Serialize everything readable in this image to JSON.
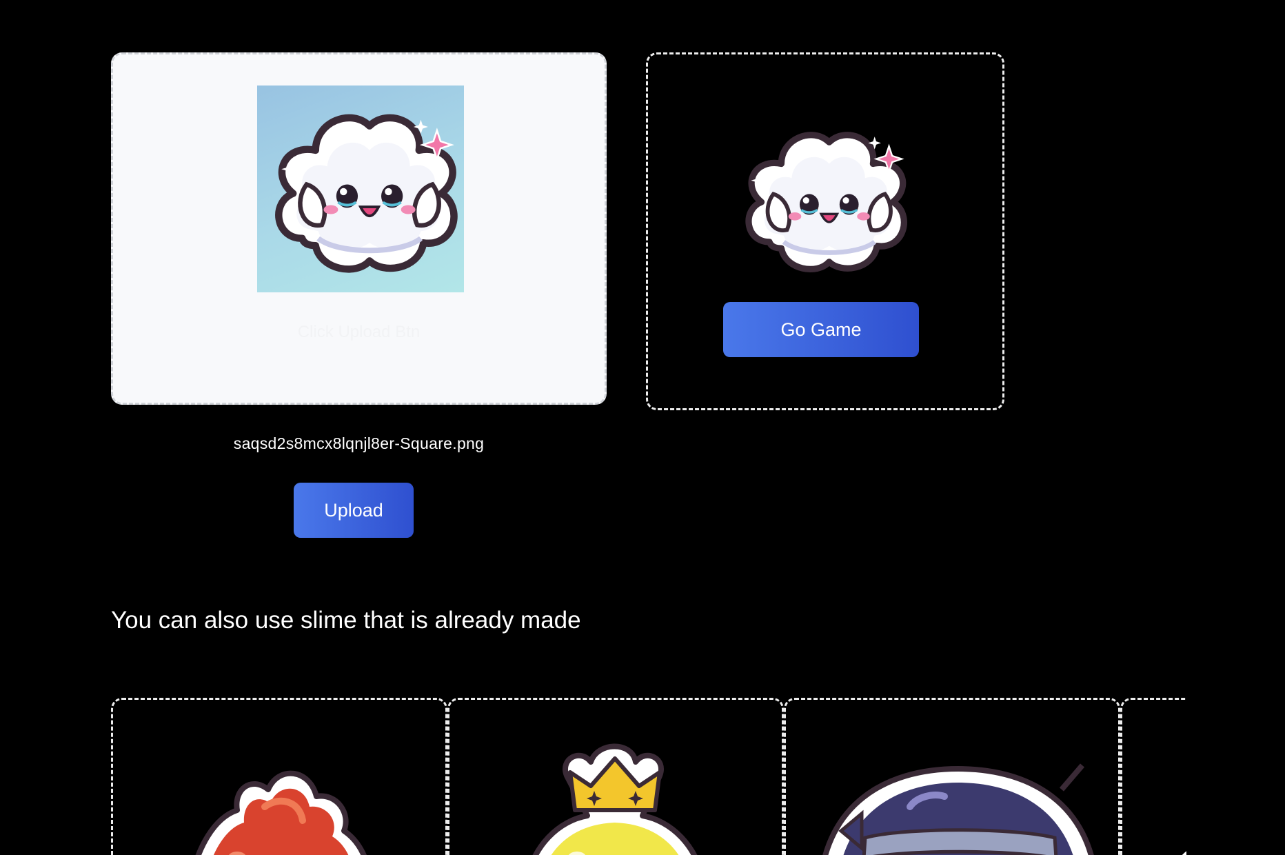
{
  "uploader": {
    "hint": "Click Upload Btn",
    "file_name": "saqsd2s8mcx8lqnjl8er-Square.png",
    "upload_label": "Upload"
  },
  "preview": {
    "go_label": "Go Game"
  },
  "gallery": {
    "title": "You can also use slime that is already made",
    "items": [
      {
        "icon": "red-slime-icon"
      },
      {
        "icon": "king-slime-icon"
      },
      {
        "icon": "ninja-slime-icon"
      },
      {
        "icon": "slime-icon"
      }
    ]
  },
  "colors": {
    "background": "#000000",
    "button_start": "#4a78ea",
    "button_end": "#2f50d0",
    "upload_box": "#f8f9fb"
  }
}
